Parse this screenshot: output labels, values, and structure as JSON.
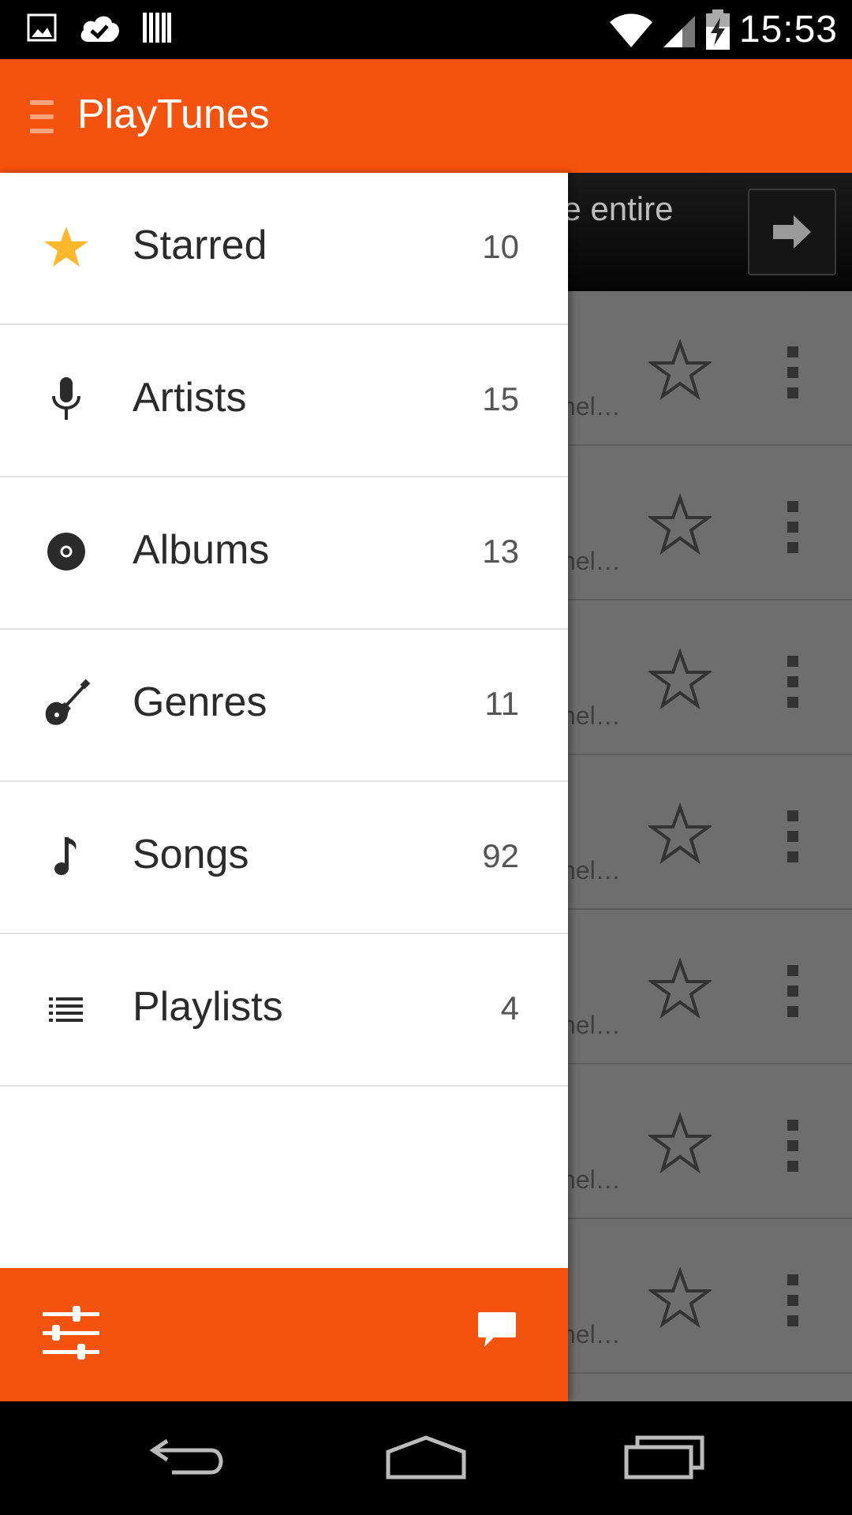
{
  "status_bar": {
    "time": "15:53",
    "icons": [
      "image-icon",
      "cloud-check-icon",
      "barcode-icon",
      "wifi-icon",
      "signal-icon",
      "battery-charging-icon"
    ]
  },
  "app_bar": {
    "title": "PlayTunes",
    "menu_icon": "hamburger-icon"
  },
  "background": {
    "banner_text": "he entire",
    "row_text": "nel…",
    "row_count": 7
  },
  "drawer": {
    "items": [
      {
        "icon": "star-icon",
        "label": "Starred",
        "count": "10"
      },
      {
        "icon": "microphone-icon",
        "label": "Artists",
        "count": "15"
      },
      {
        "icon": "disc-icon",
        "label": "Albums",
        "count": "13"
      },
      {
        "icon": "guitar-icon",
        "label": "Genres",
        "count": "11"
      },
      {
        "icon": "music-note-icon",
        "label": "Songs",
        "count": "92"
      },
      {
        "icon": "list-icon",
        "label": "Playlists",
        "count": "4"
      }
    ],
    "footer": {
      "left_icon": "equalizer-settings-icon",
      "right_icon": "chat-icon"
    }
  },
  "colors": {
    "accent": "#f4520d",
    "star": "#ffb72b",
    "text": "#2b2b2b"
  }
}
